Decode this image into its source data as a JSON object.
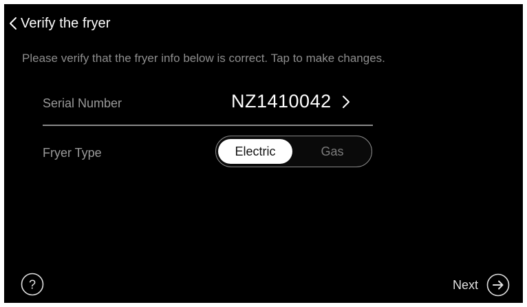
{
  "header": {
    "title": "Verify the fryer",
    "back_icon": "chevron-left-icon"
  },
  "instructions": "Please verify that the fryer info below is correct. Tap to make changes.",
  "serial": {
    "label": "Serial Number",
    "value": "NZ1410042",
    "icon": "chevron-right-icon"
  },
  "fryer_type": {
    "label": "Fryer Type",
    "options": [
      "Electric",
      "Gas"
    ],
    "selected": "Electric"
  },
  "footer": {
    "help_icon": "question-mark-icon",
    "help_text": "?",
    "next_label": "Next",
    "next_icon": "arrow-right-circle-icon"
  },
  "colors": {
    "background": "#000000",
    "text_primary": "#ffffff",
    "text_secondary": "#9a9a9a",
    "selected_fill": "#ffffff",
    "divider": "#8a8a8a"
  }
}
